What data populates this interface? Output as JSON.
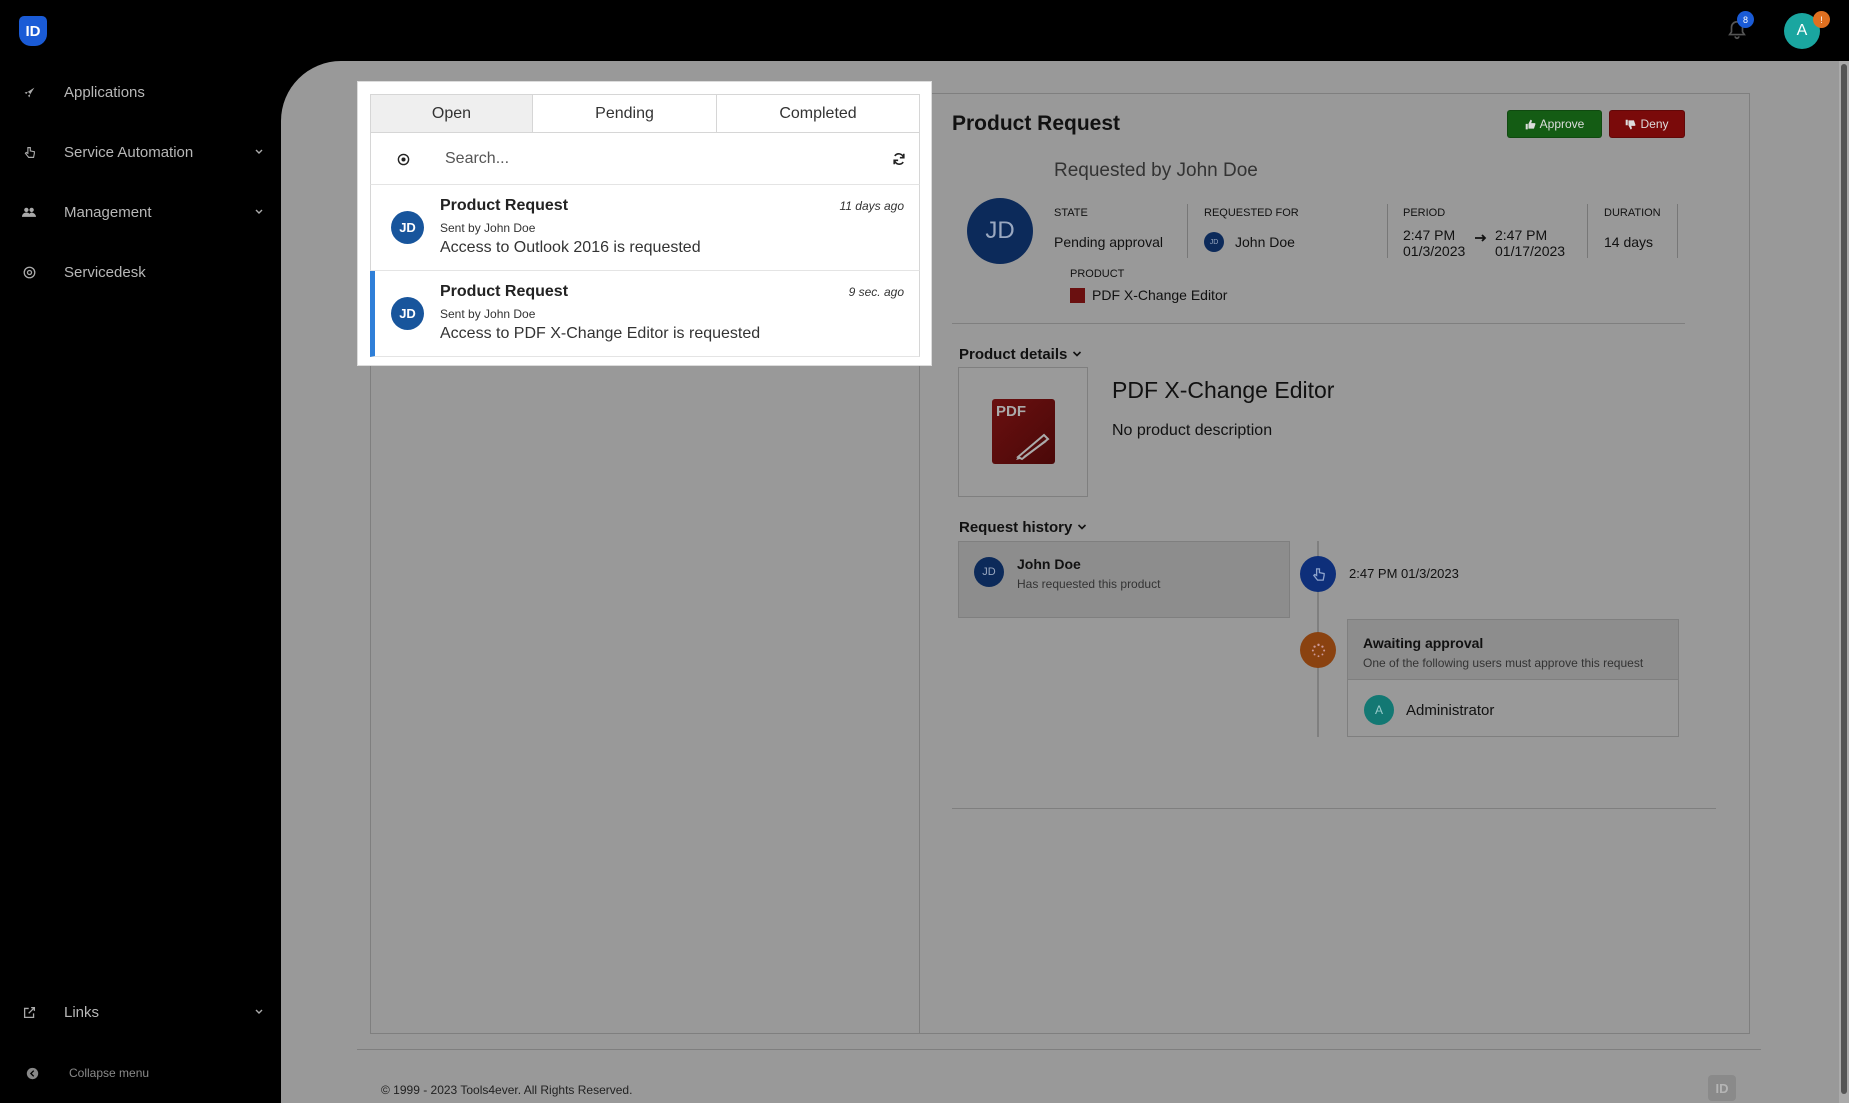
{
  "header": {
    "logo_text": "ID",
    "notification_count": "8",
    "user_initial": "A",
    "user_badge": "!"
  },
  "sidebar": {
    "items": [
      {
        "label": "Applications",
        "icon": "rocket-icon"
      },
      {
        "label": "Service Automation",
        "icon": "hand-pointer-icon"
      },
      {
        "label": "Management",
        "icon": "users-icon"
      },
      {
        "label": "Servicedesk",
        "icon": "lifebuoy-icon"
      }
    ],
    "links_label": "Links",
    "collapse_label": "Collapse menu"
  },
  "request_list": {
    "tabs": [
      {
        "label": "Open",
        "active": true
      },
      {
        "label": "Pending",
        "active": false
      },
      {
        "label": "Completed",
        "active": false
      }
    ],
    "search_placeholder": "Search...",
    "items": [
      {
        "initials": "JD",
        "title": "Product Request",
        "sender": "Sent by John Doe",
        "description": "Access to Outlook 2016 is requested",
        "time": "11 days ago",
        "selected": false
      },
      {
        "initials": "JD",
        "title": "Product Request",
        "sender": "Sent by John Doe",
        "description": "Access to PDF X-Change Editor is requested",
        "time": "9 sec. ago",
        "selected": true
      }
    ]
  },
  "detail": {
    "title": "Product Request",
    "approve_label": "Approve",
    "deny_label": "Deny",
    "requested_by": "Requested by John Doe",
    "requester_initials": "JD",
    "state_label": "STATE",
    "state_value": "Pending approval",
    "requested_for_label": "REQUESTED FOR",
    "requested_for_initials": "JD",
    "requested_for_value": "John Doe",
    "period_label": "PERIOD",
    "period_start_time": "2:47 PM",
    "period_start_date": "01/3/2023",
    "period_end_time": "2:47 PM",
    "period_end_date": "01/17/2023",
    "duration_label": "DURATION",
    "duration_value": "14 days",
    "product_label": "PRODUCT",
    "product_value": "PDF X-Change Editor",
    "product_details_heading": "Product details",
    "product_logo_text": "PDF",
    "product_name": "PDF X-Change Editor",
    "product_description": "No product description",
    "history_heading": "Request history",
    "history": {
      "initials": "JD",
      "name": "John Doe",
      "action": "Has requested this product",
      "time": "2:47 PM 01/3/2023",
      "await_title": "Awaiting approval",
      "await_sub": "One of the following users must approve this request",
      "approver_initial": "A",
      "approver_name": "Administrator"
    }
  },
  "footer": {
    "copyright": "© 1999 - 2023 Tools4ever. All Rights Reserved.",
    "logo_text": "ID"
  },
  "colors": {
    "accent_blue": "#2f7fd8",
    "approve_green": "#145c14",
    "deny_red": "#7a0a0a",
    "avatar_blue": "#18559c"
  }
}
